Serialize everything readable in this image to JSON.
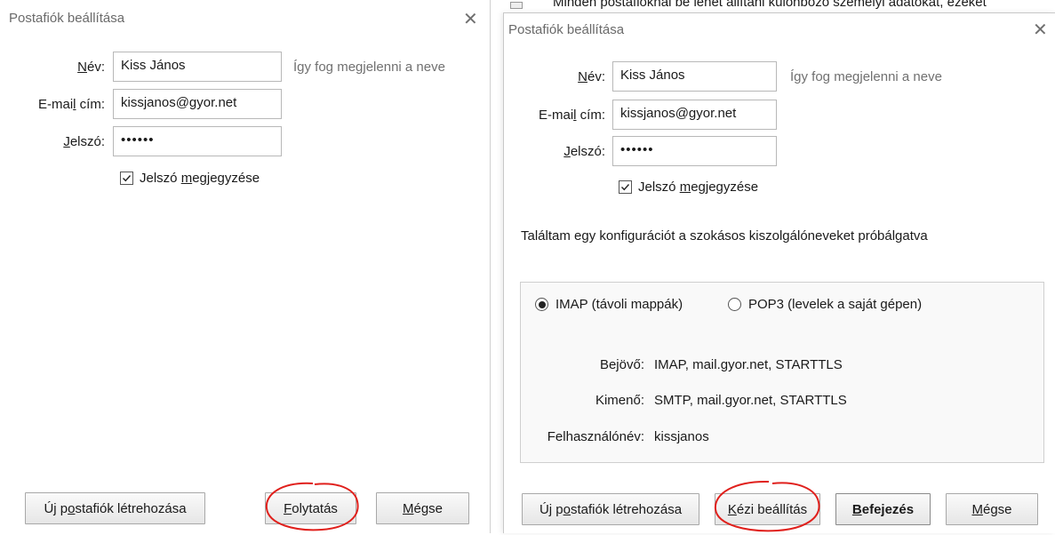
{
  "left_dialog": {
    "title": "Postafiók beállítása",
    "close_glyph": "✕",
    "name_label": {
      "pre": "",
      "u": "N",
      "post": "év:"
    },
    "name_value": "Kiss János",
    "name_hint": "Így fog megjelenni a neve",
    "email_label": {
      "pre": "E-mai",
      "u": "l",
      "post": " cím:"
    },
    "email_value": "kissjanos@gyor.net",
    "password_label": {
      "pre": "",
      "u": "J",
      "post": "elszó:"
    },
    "password_value": "••••••",
    "remember": {
      "pre": "Jelszó ",
      "u": "m",
      "post": "egjegyzése",
      "checked": true
    },
    "buttons": {
      "new_account": {
        "pre": "Új p",
        "u": "o",
        "post": "stafiók létrehozása"
      },
      "continue": {
        "pre": "",
        "u": "F",
        "post": "olytatás"
      },
      "cancel": {
        "pre": "",
        "u": "M",
        "post": "égse"
      }
    }
  },
  "right_dialog": {
    "background_text": "Minden postafióknál be lehet állítani különböző személyi adatokat, ezeket",
    "title": "Postafiók beállítása",
    "close_glyph": "✕",
    "name_label": {
      "pre": "",
      "u": "N",
      "post": "év:"
    },
    "name_value": "Kiss János",
    "name_hint": "Így fog megjelenni a neve",
    "email_label": {
      "pre": "E-mai",
      "u": "l",
      "post": " cím:"
    },
    "email_value": "kissjanos@gyor.net",
    "password_label": {
      "pre": "",
      "u": "J",
      "post": "elszó:"
    },
    "password_value": "••••••",
    "remember": {
      "pre": "Jelszó ",
      "u": "m",
      "post": "egjegyzése",
      "checked": true
    },
    "found_config_text": "Találtam egy konfigurációt a szokásos kiszolgálóneveket próbálgatva",
    "protocols": [
      {
        "label": "IMAP (távoli mappák)",
        "selected": true
      },
      {
        "label": "POP3 (levelek a saját gépen)",
        "selected": false
      }
    ],
    "incoming": {
      "label": "Bejövő:",
      "value": "IMAP, mail.gyor.net, STARTTLS"
    },
    "outgoing": {
      "label": "Kimenő:",
      "value": "SMTP, mail.gyor.net, STARTTLS"
    },
    "username": {
      "label": "Felhasználónév:",
      "value": "kissjanos"
    },
    "buttons": {
      "new_account": {
        "pre": "Új p",
        "u": "o",
        "post": "stafiók létrehozása"
      },
      "manual": {
        "pre": "",
        "u": "K",
        "post": "ézi beállítás"
      },
      "finish": {
        "pre": "",
        "u": "B",
        "post": "efejezés"
      },
      "cancel": {
        "pre": "",
        "u": "M",
        "post": "égse"
      }
    }
  },
  "colors": {
    "annotation": "#e0201c",
    "title_text": "#6a6a6a",
    "hint_text": "#707070"
  }
}
